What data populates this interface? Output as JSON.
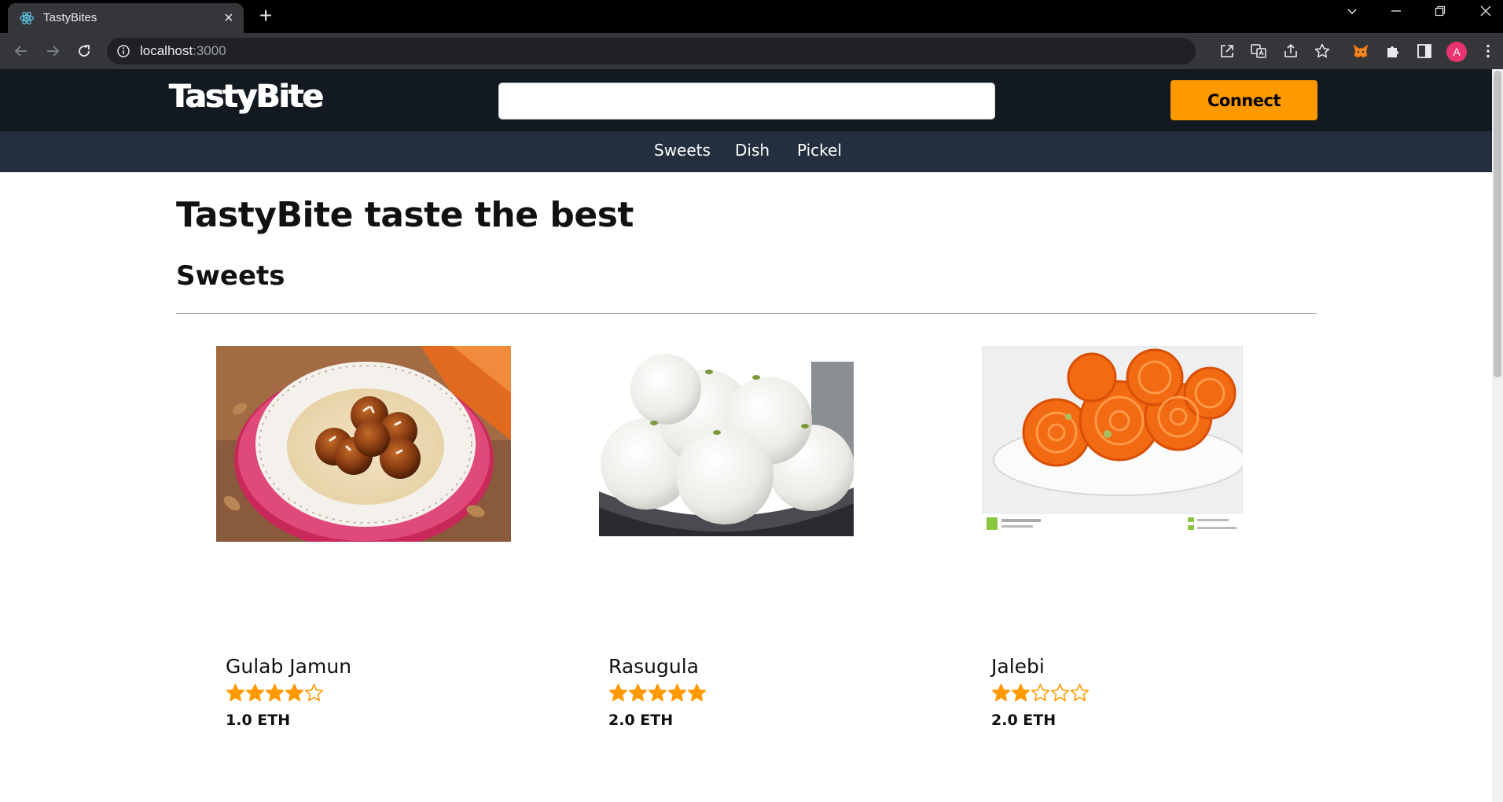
{
  "browser": {
    "tab_title": "TastyBites",
    "url_host": "localhost",
    "url_port": ":3000",
    "profile_initial": "A"
  },
  "site": {
    "logo": "TastyBite",
    "search": {
      "value": "",
      "placeholder": ""
    },
    "connect_label": "Connect",
    "nav": [
      "Sweets",
      "Dish",
      "Pickel"
    ],
    "hero_title": "TastyBite taste the best",
    "section_title": "Sweets",
    "colors": {
      "header_bg": "#131921",
      "subnav_bg": "#232f3e",
      "accent": "#ff9900",
      "star": "#ff9900"
    }
  },
  "products": [
    {
      "name": "Gulab Jamun",
      "rating": 4,
      "max_rating": 5,
      "price": "1.0 ETH",
      "image": "gulab-jamun-photo"
    },
    {
      "name": "Rasugula",
      "rating": 5,
      "max_rating": 5,
      "price": "2.0 ETH",
      "image": "rasgulla-photo"
    },
    {
      "name": "Jalebi",
      "rating": 2,
      "max_rating": 5,
      "price": "2.0 ETH",
      "image": "jalebi-photo"
    }
  ]
}
